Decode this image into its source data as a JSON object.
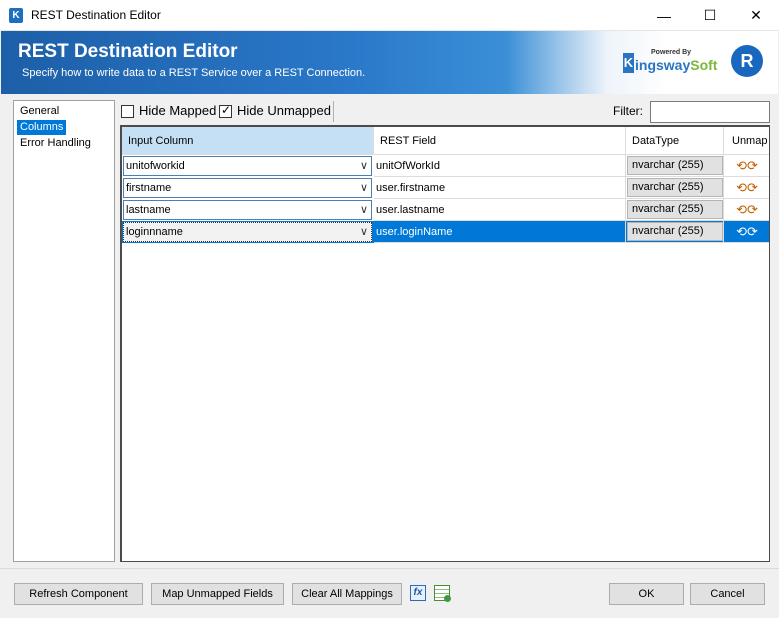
{
  "window": {
    "title": "REST Destination Editor",
    "app_icon_letter": "K",
    "minimize_glyph": "—",
    "maximize_glyph": "☐",
    "close_glyph": "✕"
  },
  "banner": {
    "title": "REST Destination Editor",
    "subtitle": "Specify how to write data to a REST Service over a REST Connection.",
    "logo_powered_by": "Powered By",
    "logo_k": "K",
    "logo_name_main": "ingsway",
    "logo_name_soft": "Soft",
    "badge_letter": "R"
  },
  "nav": {
    "items": [
      {
        "label": "General",
        "selected": false
      },
      {
        "label": "Columns",
        "selected": true
      },
      {
        "label": "Error Handling",
        "selected": false
      }
    ]
  },
  "toolbar": {
    "hide_mapped_label": "Hide Mapped",
    "hide_mapped_checked": false,
    "hide_unmapped_label": "Hide Unmapped",
    "hide_unmapped_checked": true,
    "filter_label": "Filter:",
    "filter_value": ""
  },
  "grid": {
    "headers": {
      "input_column": "Input Column",
      "rest_field": "REST Field",
      "data_type": "DataType",
      "unmap": "Unmap"
    },
    "rows": [
      {
        "input": "unitofworkid",
        "rest_field": "unitOfWorkId",
        "data_type": "nvarchar (255)",
        "selected": false
      },
      {
        "input": "firstname",
        "rest_field": "user.firstname",
        "data_type": "nvarchar (255)",
        "selected": false
      },
      {
        "input": "lastname",
        "rest_field": "user.lastname",
        "data_type": "nvarchar (255)",
        "selected": false
      },
      {
        "input": "loginnname",
        "rest_field": "user.loginName",
        "data_type": "nvarchar (255)",
        "selected": true
      }
    ],
    "combo_arrow_glyph": "∨",
    "unmap_glyph": "⟲⟳"
  },
  "buttons": {
    "refresh": "Refresh Component",
    "map_unmapped": "Map Unmapped Fields",
    "clear_all": "Clear All Mappings",
    "fx": "fx",
    "ok": "OK",
    "cancel": "Cancel"
  },
  "colors": {
    "selection": "#0078d7",
    "banner": "#2a78c9",
    "header_selected": "#c5e0f5"
  }
}
